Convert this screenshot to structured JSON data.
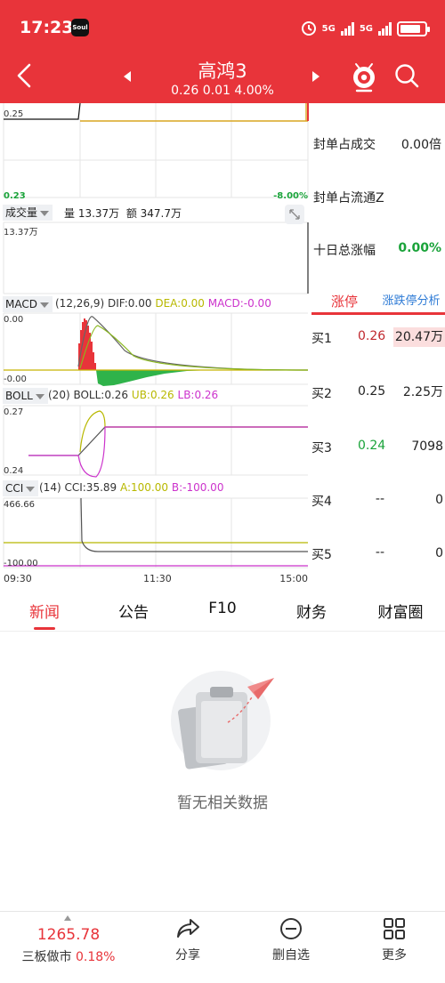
{
  "status_bar": {
    "time": "17:23",
    "app_badge": "Soul",
    "net1": "5G",
    "net2": "5G"
  },
  "header": {
    "title": "高鸿3",
    "quote": "0.26 0.01 4.00%",
    "back_icon": "back-chevron-icon",
    "prev_icon": "prev-stock-icon",
    "next_icon": "next-stock-icon",
    "robot_icon": "robot-assistant-icon",
    "search_icon": "search-icon",
    "bg_color": "#e8343a"
  },
  "price_chart": {
    "y_top": "0.25",
    "y_bottom": "0.23",
    "pct_bottom": "-8.00%",
    "line_color": "#d9a520"
  },
  "volume": {
    "name": "成交量",
    "vol": "量 13.37万",
    "amount": "额 347.7万",
    "y_top": "13.37万"
  },
  "macd": {
    "name": "MACD",
    "params": "(12,26,9)",
    "dif": "DIF:0.00",
    "dea": "DEA:0.00",
    "macd": "MACD:-0.00",
    "y_top": "0.00",
    "y_bottom": "-0.00"
  },
  "boll": {
    "name": "BOLL",
    "params": "(20)",
    "boll": "BOLL:0.26",
    "ub": "UB:0.26",
    "lb": "LB:0.26",
    "y_top": "0.27",
    "y_bottom": "0.24"
  },
  "cci": {
    "name": "CCI",
    "params": "(14)",
    "cci": "CCI:35.89",
    "a": "A:100.00",
    "b": "B:-100.00",
    "y_top": "466.66",
    "y_bottom": "-100.00"
  },
  "time_axis": [
    "09:30",
    "11:30",
    "15:00"
  ],
  "side_stats": [
    {
      "label": "封单占成交",
      "value": "0.00倍",
      "color": "#222222"
    },
    {
      "label": "封单占流通Z",
      "value": "",
      "color": "#222222"
    },
    {
      "label": "十日总涨幅",
      "value": "0.00%",
      "color": "#1aa33a"
    }
  ],
  "limit_tabs": {
    "limit": "涨停",
    "analysis": "涨跌停分析"
  },
  "bids": [
    {
      "label": "买1",
      "price": "0.26",
      "volume": "20.47万",
      "price_color": "#c0282e",
      "highlight": true
    },
    {
      "label": "买2",
      "price": "0.25",
      "volume": "2.25万",
      "price_color": "#222222",
      "highlight": false
    },
    {
      "label": "买3",
      "price": "0.24",
      "volume": "7098",
      "price_color": "#1aa33a",
      "highlight": false
    },
    {
      "label": "买4",
      "price": "--",
      "volume": "0",
      "price_color": "#222222",
      "highlight": false
    },
    {
      "label": "买5",
      "price": "--",
      "volume": "0",
      "price_color": "#222222",
      "highlight": false
    }
  ],
  "news_tabs": [
    "新闻",
    "公告",
    "F10",
    "财务",
    "财富圈"
  ],
  "active_tab": "新闻",
  "empty_state": {
    "text": "暂无相关数据",
    "icon": "empty-clipboard-icon"
  },
  "bottom_bar": {
    "index_value": "1265.78",
    "index_name": "三板做市",
    "index_pct": "0.18%",
    "share": "分享",
    "remove": "删自选",
    "more": "更多"
  },
  "colors": {
    "up": "#e8343a",
    "down": "#1aa33a",
    "yellow": "#c8b400",
    "magenta": "#cc33cc"
  }
}
